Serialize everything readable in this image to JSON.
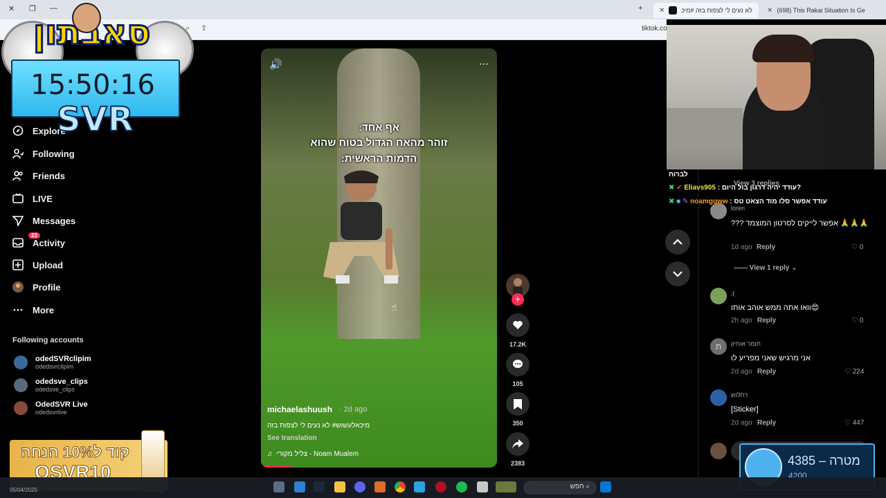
{
  "browser": {
    "tabs": [
      {
        "title": "לא נעים לי לצפות בזה #מיכ",
        "favicon_color": "#111111"
      },
      {
        "title": "(698) This Rakai Situation Is Get",
        "favicon_color": "#ff0000"
      }
    ],
    "url": "tiktok.co"
  },
  "clock_overlay": {
    "logo": "סאבתון",
    "time": "15:50:16",
    "tag": "SVR"
  },
  "sidebar": {
    "nav": [
      {
        "label": "Explore",
        "icon": "compass-icon"
      },
      {
        "label": "Following",
        "icon": "user-follow-icon"
      },
      {
        "label": "Friends",
        "icon": "friends-icon"
      },
      {
        "label": "LIVE",
        "icon": "live-icon"
      },
      {
        "label": "Messages",
        "icon": "send-icon"
      },
      {
        "label": "Activity",
        "icon": "inbox-icon",
        "badge": "23"
      },
      {
        "label": "Upload",
        "icon": "plus-square-icon"
      },
      {
        "label": "Profile",
        "icon": "avatar"
      },
      {
        "label": "More",
        "icon": "more-icon"
      }
    ],
    "following_title": "Following accounts",
    "accounts": [
      {
        "name": "odedSVRclipim",
        "handle": "odedsvrclipim"
      },
      {
        "name": "odedsve_clips",
        "handle": "odedsve_clips"
      },
      {
        "name": "OdedSVR Live",
        "handle": "odedsvrlive"
      }
    ]
  },
  "video": {
    "caption_lines": [
      "אף אחד:",
      "זוהר מהאח הגדול בטוח שהוא",
      "הדמות הראשית:"
    ],
    "username": "michaelashuush",
    "time": "· 2d ago",
    "description": "מיכאלעשוש# לא נעים לי לצפות בזה",
    "see_translation": "See translation",
    "sound": "צליל מקורי - Noam Mualem",
    "progress": 0.13
  },
  "actions": {
    "likes": "17.2K",
    "comments": "105",
    "saves": "350",
    "shares": "2383"
  },
  "comments": [
    {
      "name": "loren",
      "text": "??? אפשר לייקים לסרטון המוצמד 🙏🙏🙏",
      "time": "1d ago",
      "reply": "Reply",
      "likes": "0"
    },
    {
      "name": ";(",
      "text": "וואו אתה ממש אוהב אותו😍",
      "time": "2h ago",
      "reply": "Reply",
      "likes": "0",
      "avatar_color": "#7aa05a"
    },
    {
      "name": "תומר אוחיון",
      "text": "אני מרגיש שאני מפריע לו",
      "time": "2d ago",
      "reply": "Reply",
      "likes": "224",
      "initial": "ת",
      "avatar_color": "#6e6e6e"
    },
    {
      "name": "רחלוש",
      "text": "[Sticker]",
      "time": "2d ago",
      "reply": "Reply",
      "likes": "447",
      "avatar_color": "#2d5fa8"
    }
  ],
  "view_replies": [
    "View 3 replies",
    "View 1 reply"
  ],
  "stream_chat": [
    {
      "user": "לברוח",
      "msg": ""
    },
    {
      "user": "Eliavs905",
      "msg": "עודד יהיה דרגון בול היום?",
      "color": "#f5e042"
    },
    {
      "user": "noamgqww",
      "msg": "עודד אפשר סלו מוד הצאט טס",
      "color": "#ff9a1f"
    }
  ],
  "ad": {
    "line1": "קוד ל10% הנחה",
    "line2": "OSVR10"
  },
  "goal": {
    "current": "4385",
    "label": "מטרה",
    "target": "4200"
  },
  "taskbar": {
    "search": "חפש",
    "date": "05/04/2025"
  }
}
